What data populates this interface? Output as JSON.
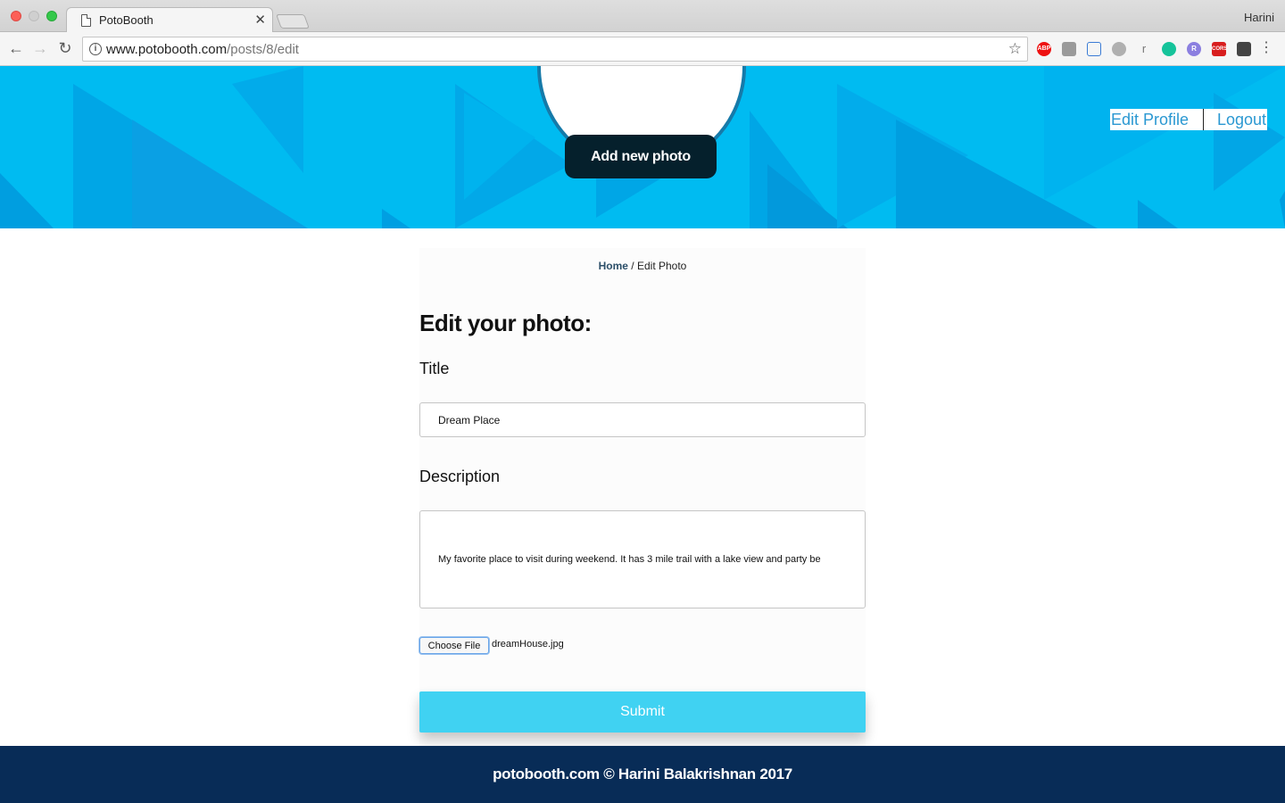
{
  "browser": {
    "tab_title": "PotoBooth",
    "tab_close": "✕",
    "profile_name": "Harini",
    "url_host": "www.potobooth.com",
    "url_path": "/posts/8/edit",
    "extensions": [
      "ABP",
      "",
      "",
      "",
      "r",
      "",
      "R",
      "CORS",
      ""
    ]
  },
  "hero": {
    "add_photo_label": "Add new photo",
    "nav": {
      "edit_profile": "Edit Profile",
      "logout": "Logout"
    }
  },
  "breadcrumb": {
    "home": "Home",
    "separator": " / ",
    "current": "Edit Photo"
  },
  "form": {
    "heading": "Edit your photo:",
    "title_label": "Title",
    "title_value": "Dream Place",
    "description_label": "Description",
    "description_value": "My favorite place to visit during weekend. It has 3 mile trail with a lake view and party be",
    "file_button_label": "Choose File",
    "file_name": "dreamHouse.jpg",
    "submit_label": "Submit"
  },
  "footer": {
    "text": "potobooth.com © Harini Balakrishnan 2017"
  },
  "colors": {
    "hero_bg": "#00bbf1",
    "dark_button": "#05202c",
    "link": "#2a98d2",
    "submit": "#40d2f2",
    "footer_bg": "#082c57"
  }
}
